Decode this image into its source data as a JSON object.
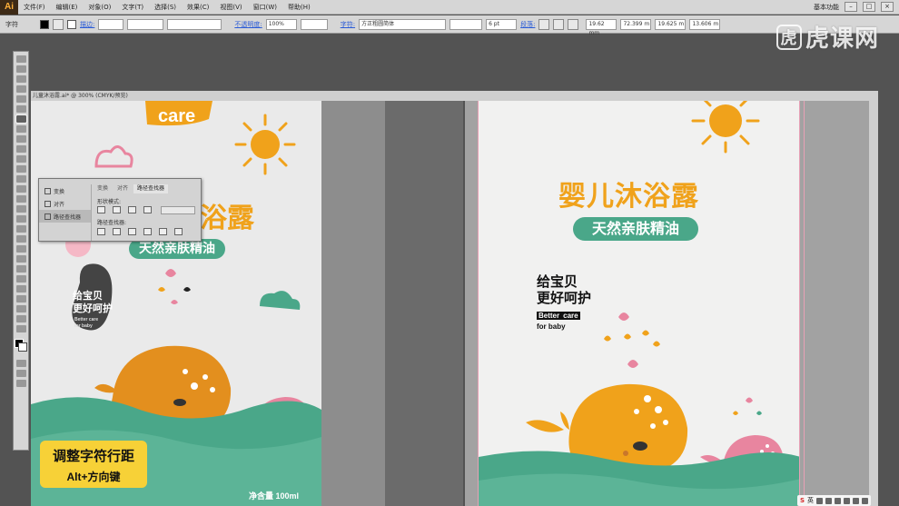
{
  "menubar": {
    "logo": "Ai",
    "items": [
      "文件(F)",
      "编辑(E)",
      "对象(O)",
      "文字(T)",
      "选择(S)",
      "效果(C)",
      "视图(V)",
      "窗口(W)",
      "帮助(H)"
    ],
    "workspace": "基本功能"
  },
  "controlbar": {
    "mode_label": "字符",
    "stroke_label": "描边:",
    "opacity_label": "不透明度:",
    "opacity_value": "100%",
    "char_label": "字符:",
    "font_value": "方正粗圆简体",
    "font_size": "6 pt",
    "para_label": "段落:",
    "x_value": "19.62 mm",
    "y_value": "72.399 m",
    "w_value": "19.625 m",
    "h_value": "13.606 m"
  },
  "watermark": {
    "badge": "虎",
    "text": "虎课网"
  },
  "left_doc": {
    "tab_title": "儿童沐浴露.ai* @ 300% (CMYK/预览)"
  },
  "float_panel": {
    "items": [
      "变换",
      "对齐",
      "路径查找器"
    ],
    "tabs": [
      "变换",
      "对齐",
      "路径查找器"
    ],
    "shape_modes": "形状模式:",
    "pathfinder": "路径查找器:"
  },
  "left_art": {
    "care": "care",
    "title": "浴露",
    "subtitle": "天然亲肤精油",
    "slogan_1": "给宝贝",
    "slogan_2": "更好呵护",
    "better": "Better care",
    "for_baby": "for baby",
    "volume": "净含量 100ml"
  },
  "right_art": {
    "title": "婴儿沐浴露",
    "subtitle": "天然亲肤精油",
    "slogan_1": "给宝贝",
    "slogan_2": "更好呵护",
    "better": "Better",
    "care": "care",
    "for_baby": "for baby"
  },
  "caption": {
    "line1": "调整字符行距",
    "line2": "Alt+方向键"
  },
  "status": {
    "ime": "S",
    "lang": "英"
  },
  "colors": {
    "orange": "#f0a21b",
    "teal": "#4aa789",
    "pink": "#e8859f",
    "yellow_caption": "#f7d137"
  }
}
